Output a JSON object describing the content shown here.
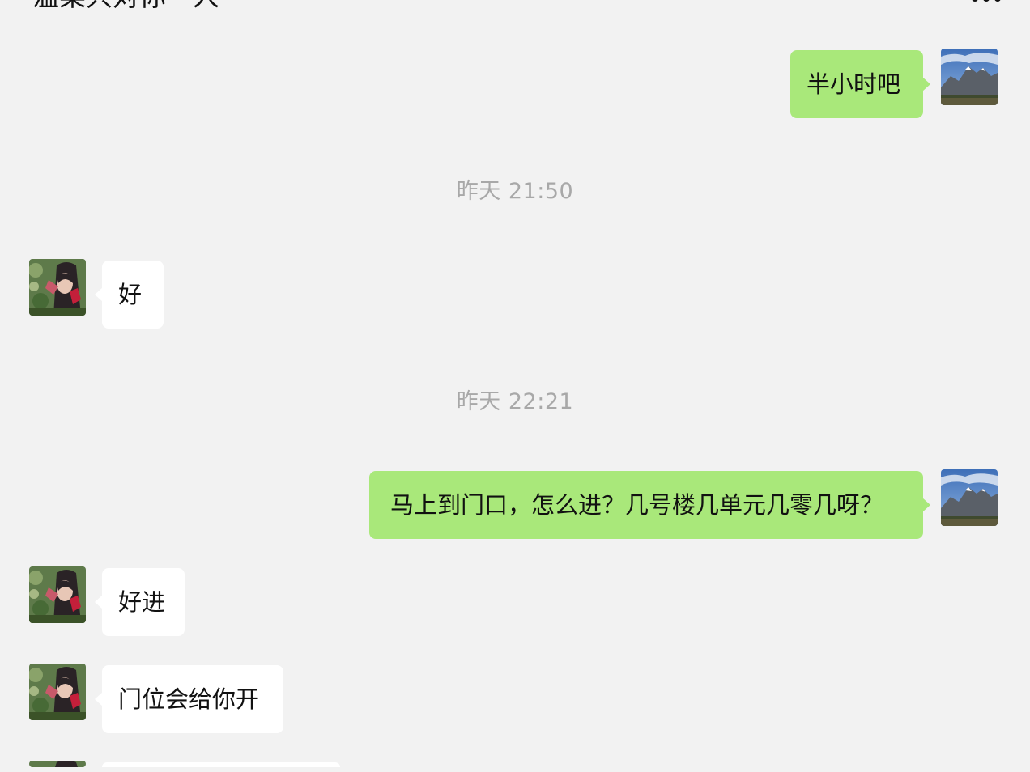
{
  "header": {
    "title": "温柔只对你一人",
    "more_icon": "more-dots-icon"
  },
  "messages": [
    {
      "direction": "outgoing",
      "text": "半小时吧"
    },
    {
      "type": "timestamp",
      "text": "昨天 21:50"
    },
    {
      "direction": "incoming",
      "text": "好"
    },
    {
      "type": "timestamp",
      "text": "昨天 22:21"
    },
    {
      "direction": "outgoing",
      "text": "马上到门口，怎么进？几号楼几单元几零几呀？"
    },
    {
      "direction": "incoming",
      "text": "好进"
    },
    {
      "direction": "incoming",
      "text": "门位会给你开"
    }
  ],
  "colors": {
    "background": "#f2f2f2",
    "outgoing_bubble": "#a9e87a",
    "incoming_bubble": "#ffffff",
    "timestamp_text": "#a8a8a8"
  },
  "avatars": {
    "self": "mountain-landscape-avatar",
    "contact": "woman-with-flowers-avatar"
  }
}
